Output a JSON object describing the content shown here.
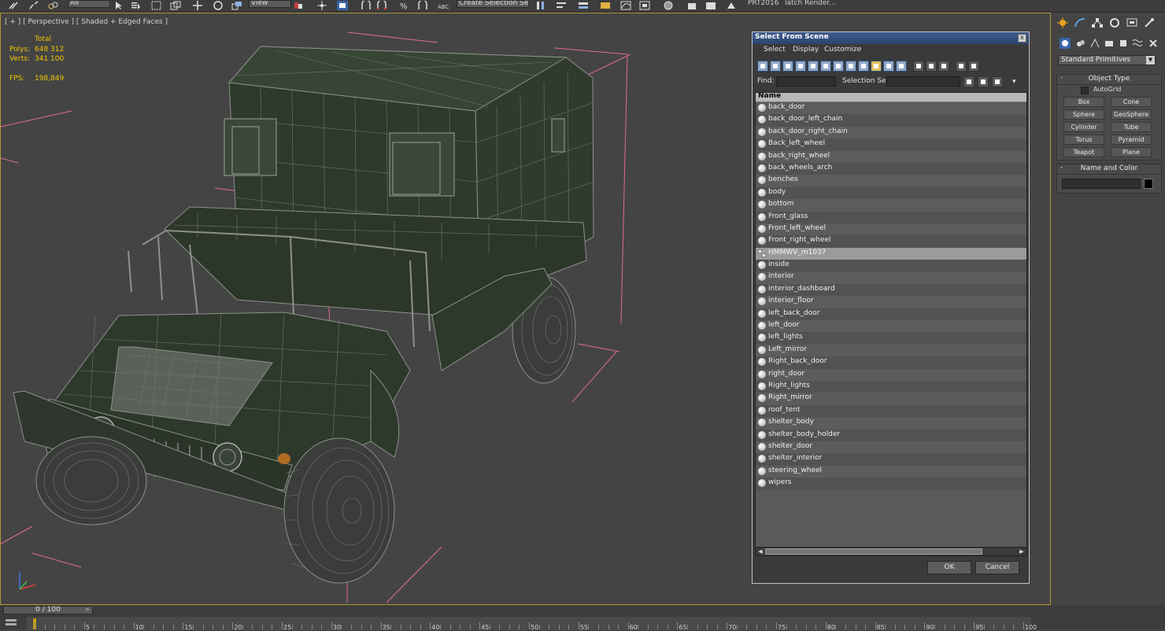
{
  "toolbar": {
    "selection_filter": "All",
    "view_label": "View",
    "named_selection": "Create Selection Se",
    "workspace_text": "PRT2016",
    "batch_render": "latch Render..."
  },
  "viewport": {
    "label": "[ + ] [ Perspective ] [ Shaded + Edged Faces ]",
    "stats": {
      "total_label": "Total",
      "polys_label": "Polys:",
      "polys_value": "648 312",
      "verts_label": "Verts:",
      "verts_value": "341 100",
      "fps_label": "FPS:",
      "fps_value": "198,849"
    }
  },
  "dialog": {
    "title": "Select From Scene",
    "close": "x",
    "menu": [
      "Select",
      "Display",
      "Customize"
    ],
    "find_label": "Find:",
    "find_value": "",
    "selection_set_label": "Selection Set:",
    "selection_set_value": "",
    "column_name": "Name",
    "objects": [
      {
        "name": "back_door",
        "type": "object",
        "selected": false
      },
      {
        "name": "back_door_left_chain",
        "type": "object",
        "selected": false
      },
      {
        "name": "back_door_right_chain",
        "type": "object",
        "selected": false
      },
      {
        "name": "Back_left_wheel",
        "type": "object",
        "selected": false
      },
      {
        "name": "back_right_wheel",
        "type": "object",
        "selected": false
      },
      {
        "name": "back_wheels_arch",
        "type": "object",
        "selected": false
      },
      {
        "name": "benches",
        "type": "object",
        "selected": false
      },
      {
        "name": "body",
        "type": "object",
        "selected": false
      },
      {
        "name": "bottom",
        "type": "object",
        "selected": false
      },
      {
        "name": "Front_glass",
        "type": "object",
        "selected": false
      },
      {
        "name": "Front_left_wheel",
        "type": "object",
        "selected": false
      },
      {
        "name": "Front_right_wheel",
        "type": "object",
        "selected": false
      },
      {
        "name": "HMMWV_m1037",
        "type": "group",
        "selected": true
      },
      {
        "name": "inside",
        "type": "object",
        "selected": false
      },
      {
        "name": "interior",
        "type": "object",
        "selected": false
      },
      {
        "name": "interior_dashboard",
        "type": "object",
        "selected": false
      },
      {
        "name": "interior_floor",
        "type": "object",
        "selected": false
      },
      {
        "name": "left_back_door",
        "type": "object",
        "selected": false
      },
      {
        "name": "left_door",
        "type": "object",
        "selected": false
      },
      {
        "name": "left_lights",
        "type": "object",
        "selected": false
      },
      {
        "name": "Left_mirror",
        "type": "object",
        "selected": false
      },
      {
        "name": "Right_back_door",
        "type": "object",
        "selected": false
      },
      {
        "name": "right_door",
        "type": "object",
        "selected": false
      },
      {
        "name": "Right_lights",
        "type": "object",
        "selected": false
      },
      {
        "name": "Right_mirror",
        "type": "object",
        "selected": false
      },
      {
        "name": "roof_tent",
        "type": "object",
        "selected": false
      },
      {
        "name": "shelter_body",
        "type": "object",
        "selected": false
      },
      {
        "name": "shelter_body_holder",
        "type": "object",
        "selected": false
      },
      {
        "name": "shelter_door",
        "type": "object",
        "selected": false
      },
      {
        "name": "shelter_interior",
        "type": "object",
        "selected": false
      },
      {
        "name": "steering_wheel",
        "type": "object",
        "selected": false
      },
      {
        "name": "wipers",
        "type": "object",
        "selected": false
      }
    ],
    "ok_label": "OK",
    "cancel_label": "Cancel"
  },
  "command_panel": {
    "category_dropdown": "Standard Primitives",
    "object_type_title": "Object Type",
    "autogrid_label": "AutoGrid",
    "primitives": [
      "Box",
      "Cone",
      "Sphere",
      "GeoSphere",
      "Cylinder",
      "Tube",
      "Torus",
      "Pyramid",
      "Teapot",
      "Plane"
    ],
    "name_color_title": "Name and Color",
    "name_value": ""
  },
  "timeline": {
    "slider_label": "0 / 100",
    "ticks": [
      5,
      10,
      15,
      20,
      25,
      30,
      35,
      40,
      45,
      50,
      55,
      60,
      65,
      70,
      75,
      80,
      85,
      90,
      95,
      100
    ],
    "range": [
      0,
      100
    ]
  },
  "colors": {
    "viewport_bg": "#444444",
    "active_border": "#b29a3e",
    "stats_text": "#f2c800",
    "model_fill": "#2f3b2c",
    "wire": "#8a8f88",
    "bbox": "#e06a9a",
    "title_bar": "#2b4572",
    "selected_row": "#9a9a9a"
  }
}
